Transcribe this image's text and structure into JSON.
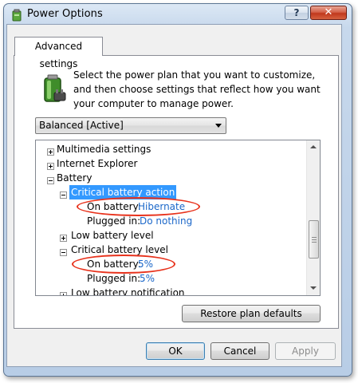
{
  "window": {
    "title": "Power Options"
  },
  "titlebar": {
    "help_label": "?",
    "close_label": "✕"
  },
  "tabs": [
    {
      "label": "Advanced settings"
    }
  ],
  "description": "Select the power plan that you want to customize, and then choose settings that reflect how you want your computer to manage power.",
  "plan_select": {
    "value": "Balanced [Active]"
  },
  "tree": {
    "multimedia": "Multimedia settings",
    "internet_explorer": "Internet Explorer",
    "battery": "Battery",
    "critical_action": "Critical battery action",
    "critical_action_on_battery_label": "On battery:",
    "critical_action_on_battery_value": "Hibernate",
    "critical_action_plugged_label": "Plugged in:",
    "critical_action_plugged_value": "Do nothing",
    "low_level": "Low battery level",
    "critical_level": "Critical battery level",
    "critical_level_on_battery_label": "On battery:",
    "critical_level_on_battery_value": "5%",
    "critical_level_plugged_label": "Plugged in:",
    "critical_level_plugged_value": "5%",
    "low_notification": "Low battery notification"
  },
  "buttons": {
    "restore": "Restore plan defaults",
    "ok": "OK",
    "cancel": "Cancel",
    "apply": "Apply"
  },
  "annotation_color": "#e8321c",
  "selection_color": "#3399ff"
}
